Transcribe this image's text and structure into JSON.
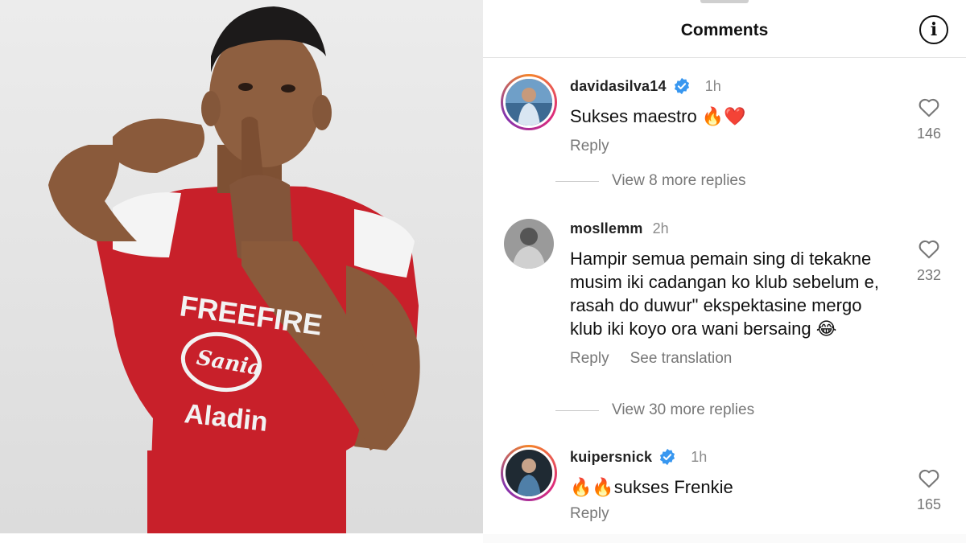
{
  "header": {
    "title": "Comments",
    "info_icon": "info-icon"
  },
  "comments": [
    {
      "username": "davidasilva14",
      "verified": true,
      "time": "1h",
      "text": "Sukses maestro 🔥❤️",
      "reply_label": "Reply",
      "likes": "146",
      "view_replies": "View 8 more replies"
    },
    {
      "username": "mosllemm",
      "verified": false,
      "time": "2h",
      "text": "Hampir semua pemain sing di tekakne musim iki cadangan ko klub sebelum e, rasah do duwur\" ekspektasine mergo klub iki koyo ora wani bersaing 😂",
      "reply_label": "Reply",
      "translation_label": "See translation",
      "likes": "232",
      "view_replies": "View 30 more replies"
    },
    {
      "username": "kuipersnick",
      "verified": true,
      "time": "1h",
      "text": "🔥🔥sukses Frenkie",
      "reply_label": "Reply",
      "likes": "165"
    }
  ],
  "photo": {
    "jersey_color": "#c8202a",
    "sponsor_texts": [
      "FREEFIRE",
      "Sania",
      "Aladin"
    ]
  },
  "colors": {
    "verified_blue": "#3897f0",
    "muted": "#777777"
  }
}
